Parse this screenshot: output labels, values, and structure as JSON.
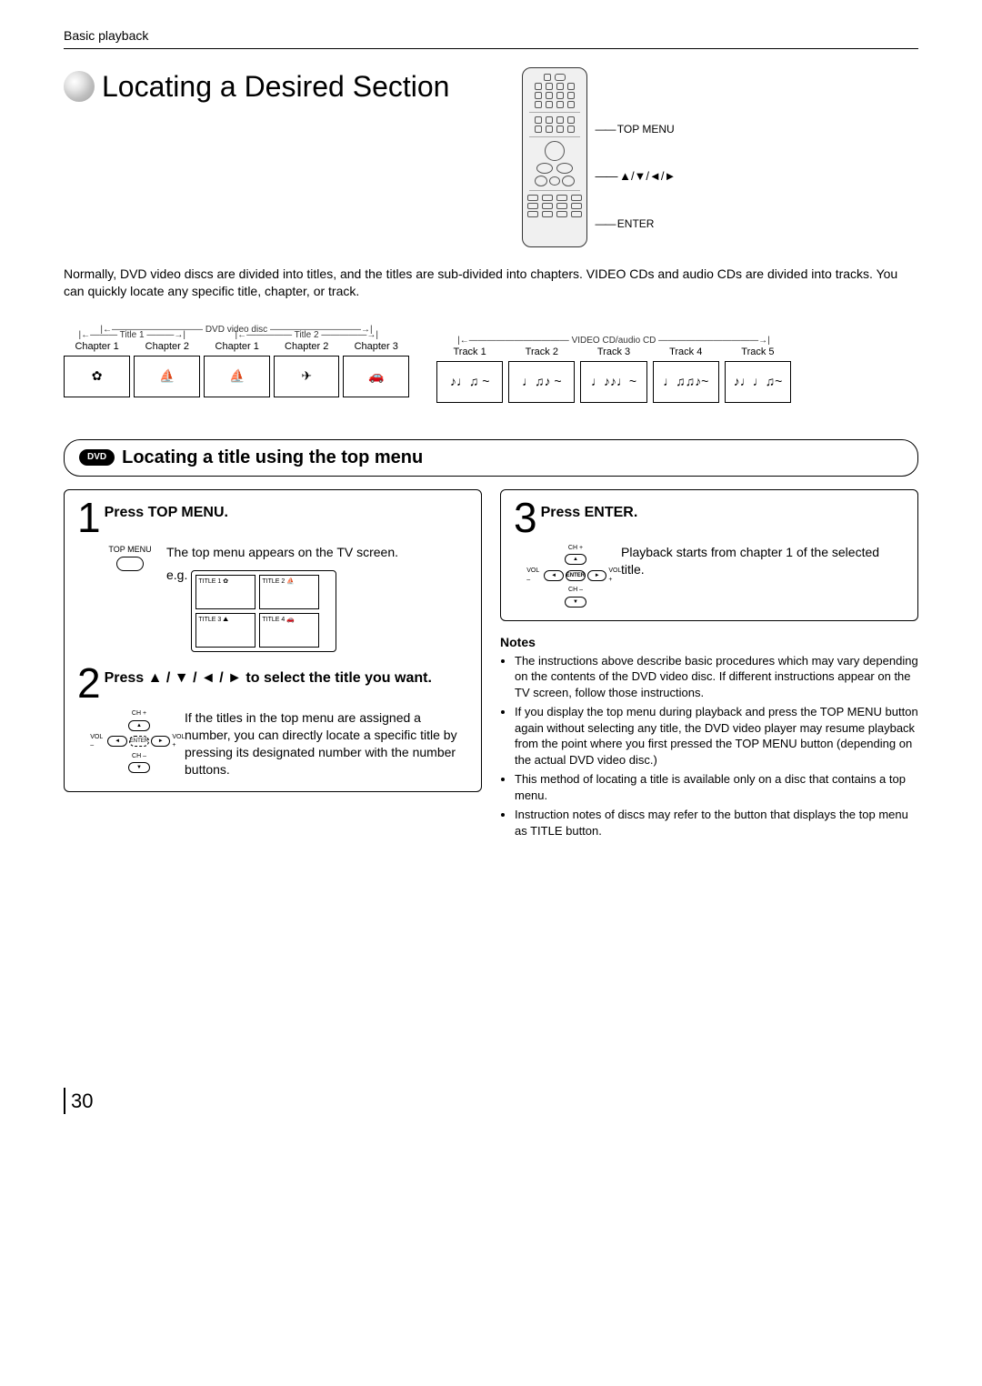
{
  "header": {
    "section_label": "Basic playback",
    "page_title": "Locating a Desired Section"
  },
  "remote_labels": {
    "top_menu": "TOP MENU",
    "arrows": "▲/▼/◄/►",
    "enter": "ENTER"
  },
  "intro": "Normally, DVD video discs are divided into titles, and the titles are sub-divided into chapters. VIDEO CDs and audio CDs are divided into tracks. You can quickly locate any specific title, chapter, or track.",
  "dvd_diagram": {
    "disc_label": "DVD video disc",
    "title1": "Title 1",
    "title2": "Title 2",
    "chapters_a": [
      "Chapter 1",
      "Chapter 2"
    ],
    "chapters_b": [
      "Chapter 1",
      "Chapter 2",
      "Chapter 3"
    ]
  },
  "cd_diagram": {
    "disc_label": "VIDEO CD/audio CD",
    "tracks": [
      "Track 1",
      "Track 2",
      "Track 3",
      "Track 4",
      "Track 5"
    ]
  },
  "subheading": {
    "pill": "DVD",
    "text": "Locating a title using the top menu"
  },
  "steps": {
    "s1": {
      "num": "1",
      "title": "Press TOP MENU.",
      "icon_label": "TOP MENU",
      "desc": "The top menu appears on the TV screen.",
      "eg": "e.g.",
      "tiles": [
        "TITLE 1",
        "TITLE 2",
        "TITLE 3",
        "TITLE 4"
      ]
    },
    "s2": {
      "num": "2",
      "title": "Press ▲ / ▼ / ◄ / ► to select the title you want.",
      "nav": {
        "chp": "CH +",
        "chm": "CH –",
        "volp": "VOL +",
        "volm": "VOL –",
        "enter": "ENTER"
      },
      "desc": "If the titles in the top menu are assigned a number, you can directly locate a specific title by pressing its designated number with the number buttons."
    },
    "s3": {
      "num": "3",
      "title": "Press ENTER.",
      "nav": {
        "chp": "CH +",
        "chm": "CH –",
        "volp": "VOL +",
        "volm": "VOL –",
        "enter": "ENTER"
      },
      "desc": "Playback starts from chapter 1 of the selected title."
    }
  },
  "notes": {
    "heading": "Notes",
    "items": [
      "The instructions above describe basic procedures which may vary depending on the contents of the DVD video disc. If different instructions appear on the TV screen, follow those instructions.",
      "If you display the top menu during playback and press the TOP MENU button again without selecting any title, the DVD video player may resume playback from the point where you first pressed the TOP MENU button (depending on the actual DVD video disc.)",
      "This method of locating a title is available only on a disc that contains a top menu.",
      "Instruction notes of discs may refer to the button that displays the top menu as TITLE button."
    ]
  },
  "page_number": "30"
}
